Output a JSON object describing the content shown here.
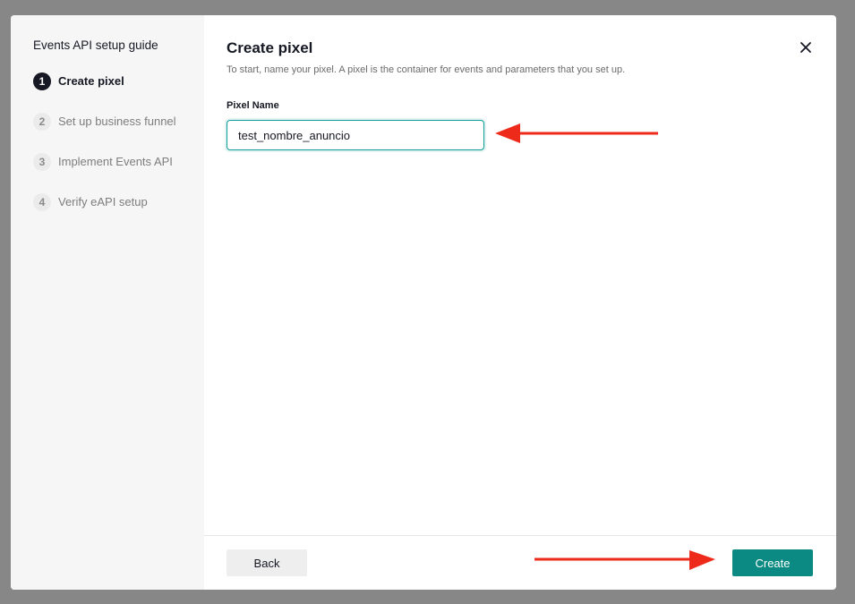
{
  "sidebar": {
    "title": "Events API setup guide",
    "steps": [
      {
        "number": "1",
        "label": "Create pixel",
        "active": true
      },
      {
        "number": "2",
        "label": "Set up business funnel",
        "active": false
      },
      {
        "number": "3",
        "label": "Implement Events API",
        "active": false
      },
      {
        "number": "4",
        "label": "Verify eAPI setup",
        "active": false
      }
    ]
  },
  "main": {
    "title": "Create pixel",
    "subtitle": "To start, name your pixel. A pixel is the container for events and parameters that you set up.",
    "field_label": "Pixel Name",
    "pixel_name_value": "test_nombre_anuncio"
  },
  "footer": {
    "back_label": "Back",
    "create_label": "Create"
  },
  "icons": {
    "close": "close-icon",
    "annotation": "arrow-icon"
  },
  "colors": {
    "accent": "#0a8a82",
    "annotation_arrow": "#ee2a1a",
    "active_step": "#161823"
  }
}
